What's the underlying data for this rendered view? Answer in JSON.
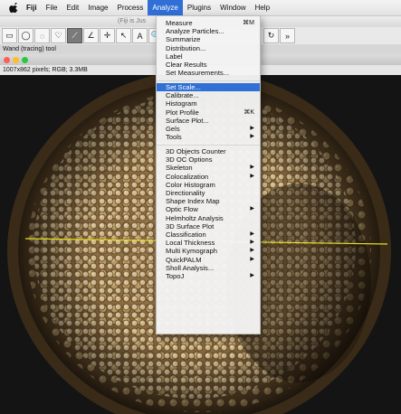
{
  "menubar": {
    "app_name": "Fiji",
    "items": [
      "File",
      "Edit",
      "Image",
      "Process",
      "Analyze",
      "Plugins",
      "Window",
      "Help"
    ],
    "active_item": "Analyze"
  },
  "toolbar_window": {
    "title_fragment": "(Fiji is Jus",
    "tool_glyphs": [
      "▭",
      "◯",
      "◌",
      "♡",
      "⟋",
      "∠",
      "✛",
      "↖",
      "A",
      "🔍"
    ],
    "right_glyphs": [
      "↻",
      "»"
    ],
    "status_text": "Wand (tracing) tool"
  },
  "image_window": {
    "info_text": "1007x862 pixels; RGB; 3.3MB"
  },
  "analyze_menu": {
    "items": [
      {
        "label": "Measure",
        "shortcut": "⌘M"
      },
      {
        "label": "Analyze Particles..."
      },
      {
        "label": "Summarize"
      },
      {
        "label": "Distribution..."
      },
      {
        "label": "Label"
      },
      {
        "label": "Clear Results"
      },
      {
        "label": "Set Measurements..."
      },
      {
        "label": "Set Scale...",
        "highlighted": true
      },
      {
        "label": "Calibrate..."
      },
      {
        "label": "Histogram"
      },
      {
        "label": "Plot Profile",
        "shortcut": "⌘K"
      },
      {
        "label": "Surface Plot..."
      },
      {
        "label": "Gels",
        "submenu": true
      },
      {
        "label": "Tools",
        "submenu": true
      },
      {
        "label": "3D Objects Counter"
      },
      {
        "label": "3D OC Options"
      },
      {
        "label": "Skeleton",
        "submenu": true
      },
      {
        "label": "Colocalization",
        "submenu": true
      },
      {
        "label": "Color Histogram"
      },
      {
        "label": "Directionality"
      },
      {
        "label": "Shape Index Map"
      },
      {
        "label": "Optic Flow",
        "submenu": true
      },
      {
        "label": "Helmholtz Analysis"
      },
      {
        "label": "3D Surface Plot"
      },
      {
        "label": "Classification",
        "submenu": true
      },
      {
        "label": "Local Thickness",
        "submenu": true
      },
      {
        "label": "Multi Kymograph",
        "submenu": true
      },
      {
        "label": "QuickPALM",
        "submenu": true
      },
      {
        "label": "Sholl Analysis..."
      },
      {
        "label": "TopoJ",
        "submenu": true
      }
    ]
  },
  "colors": {
    "highlight": "#2f6fd6",
    "scale_line": "#e8e020"
  }
}
